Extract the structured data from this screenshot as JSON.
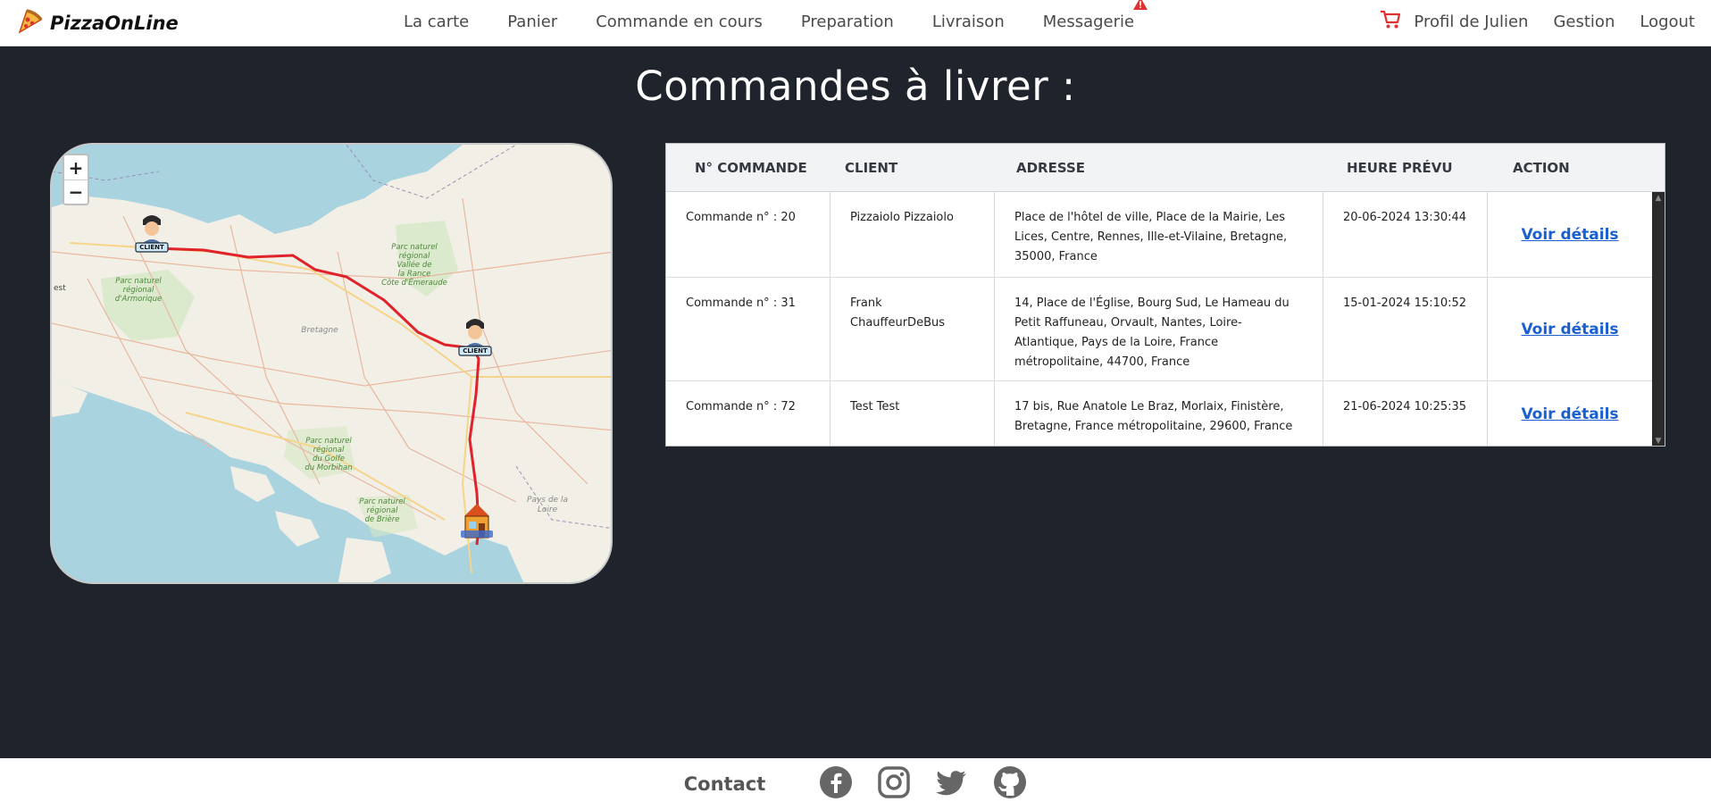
{
  "navbar": {
    "brand": "PizzaOnLine",
    "links": [
      "La carte",
      "Panier",
      "Commande en cours",
      "Preparation",
      "Livraison",
      "Messagerie"
    ],
    "profile": "Profil de Julien",
    "gestion": "Gestion",
    "logout": "Logout"
  },
  "main": {
    "title": "Commandes à livrer :"
  },
  "map": {
    "zoom_in": "+",
    "zoom_out": "−",
    "marker_label": "CLIENT",
    "labels": {
      "parc_armorique": "Parc naturel régional d'Armorique",
      "parc_rance": "Parc naturel régional Vallée de la Rance - Côte d'Émeraude",
      "bretagne": "Bretagne",
      "parc_golfe": "Parc naturel régional du Golfe du Morbihan",
      "parc_briere": "Parc naturel régional de Brière",
      "pays_loire": "Pays de la Loire",
      "brest": "est"
    }
  },
  "table": {
    "headers": [
      "N° COMMANDE",
      "CLIENT",
      "ADRESSE",
      "HEURE PRÉVU",
      "ACTION"
    ],
    "rows": [
      {
        "order": "Commande n° : 20",
        "client": "Pizzaiolo Pizzaiolo",
        "address": "Place de l'hôtel de ville, Place de la Mairie, Les Lices, Centre, Rennes, Ille-et-Vilaine, Bretagne, 35000, France",
        "time": "20-06-2024 13:30:44",
        "action": "Voir détails"
      },
      {
        "order": "Commande n° : 31",
        "client": "Frank ChauffeurDeBus",
        "address": "14, Place de l'Église, Bourg Sud, Le Hameau du Petit Raffuneau, Orvault, Nantes, Loire-Atlantique, Pays de la Loire, France métropolitaine, 44700, France",
        "time": "15-01-2024 15:10:52",
        "action": "Voir détails"
      },
      {
        "order": "Commande n° : 72",
        "client": "Test Test",
        "address": "17 bis, Rue Anatole Le Braz, Morlaix, Finistère, Bretagne, France métropolitaine, 29600, France",
        "time": "21-06-2024 10:25:35",
        "action": "Voir détails"
      }
    ]
  },
  "footer": {
    "contact": "Contact"
  },
  "colors": {
    "background": "#1f232b",
    "link": "#1a5fd0",
    "cart": "#e03131",
    "route": "#e0222a"
  },
  "icons": [
    "pizza-logo-icon",
    "alert-icon",
    "cart-icon",
    "facebook-icon",
    "instagram-icon",
    "twitter-icon",
    "github-icon"
  ]
}
